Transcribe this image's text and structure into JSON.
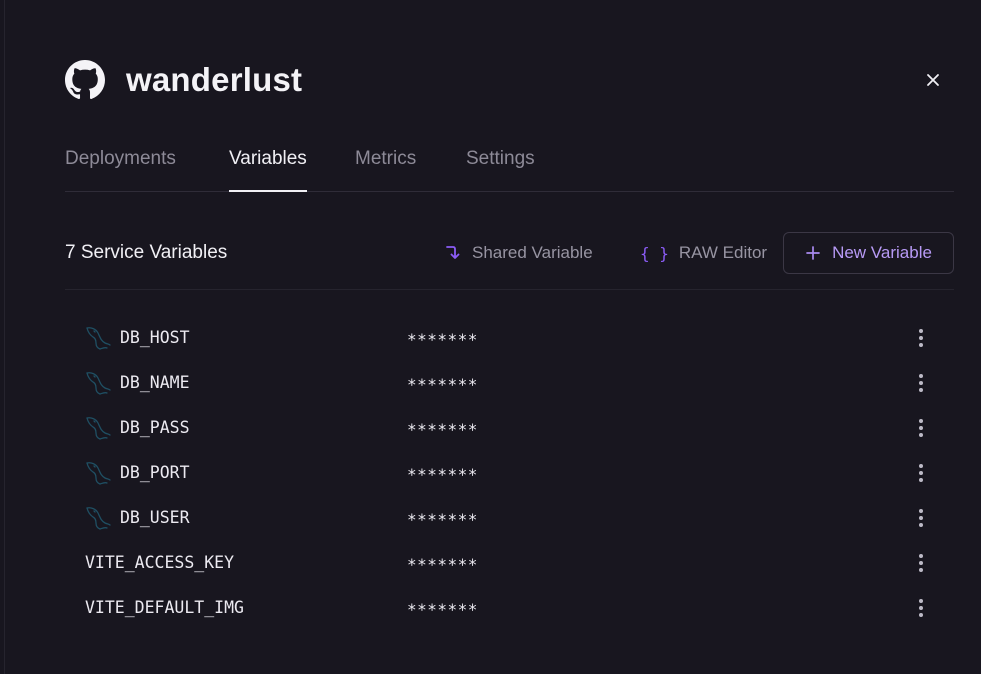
{
  "header": {
    "title": "wanderlust",
    "icon": "github-icon"
  },
  "tabs": [
    {
      "label": "Deployments",
      "active": false
    },
    {
      "label": "Variables",
      "active": true
    },
    {
      "label": "Metrics",
      "active": false
    },
    {
      "label": "Settings",
      "active": false
    }
  ],
  "section": {
    "title": "7 Service Variables",
    "shared_variable_label": "Shared Variable",
    "raw_editor_label": "RAW Editor",
    "new_variable_label": "New Variable",
    "raw_editor_glyph": "{ }"
  },
  "variables": [
    {
      "name": "DB_HOST",
      "value": "*******",
      "icon": "mysql-icon"
    },
    {
      "name": "DB_NAME",
      "value": "*******",
      "icon": "mysql-icon"
    },
    {
      "name": "DB_PASS",
      "value": "*******",
      "icon": "mysql-icon"
    },
    {
      "name": "DB_PORT",
      "value": "*******",
      "icon": "mysql-icon"
    },
    {
      "name": "DB_USER",
      "value": "*******",
      "icon": "mysql-icon"
    },
    {
      "name": "VITE_ACCESS_KEY",
      "value": "*******",
      "icon": ""
    },
    {
      "name": "VITE_DEFAULT_IMG",
      "value": "*******",
      "icon": ""
    }
  ],
  "colors": {
    "background": "#18161f",
    "accent": "#8b5cf6",
    "accent_text": "#b79af5",
    "muted_text": "#8d8a97",
    "db_icon": "#1f4f63"
  }
}
